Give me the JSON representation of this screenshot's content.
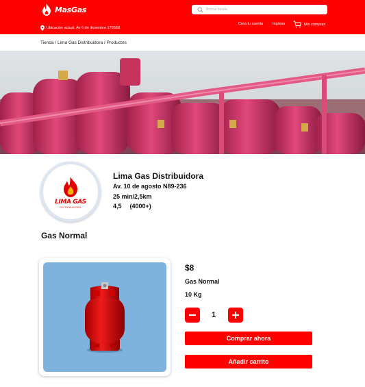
{
  "header": {
    "logo_text": "MasGas",
    "location": "Ubicación actual: Av 6 de diciembre 170589",
    "search_placeholder": "Buscar tienda",
    "nav_create_account": "Crea tu cuenta",
    "nav_login": "Ingresa",
    "nav_my_purchases": "Mis compras"
  },
  "breadcrumb": "Tienda / Lima Gas Distribuidora / Productos",
  "store": {
    "logo_name": "LIMA GAS",
    "logo_subtitle": "DISTRIBUIDORA",
    "name": "Lima Gas Distribuidora",
    "address": "Av. 10 de agosto N89-236",
    "eta": "25 min/2,5km",
    "rating": "4,5",
    "reviews": "(4000+)"
  },
  "section_title": "Gas Normal",
  "product": {
    "price": "$8",
    "name": "Gas Normal",
    "weight": "10 Kg",
    "quantity": "1",
    "buy_label": "Comprar ahora",
    "add_cart_label": "Añadir carrito"
  },
  "colors": {
    "brand_red": "#ff0000",
    "product_bg": "#7fb3de"
  }
}
